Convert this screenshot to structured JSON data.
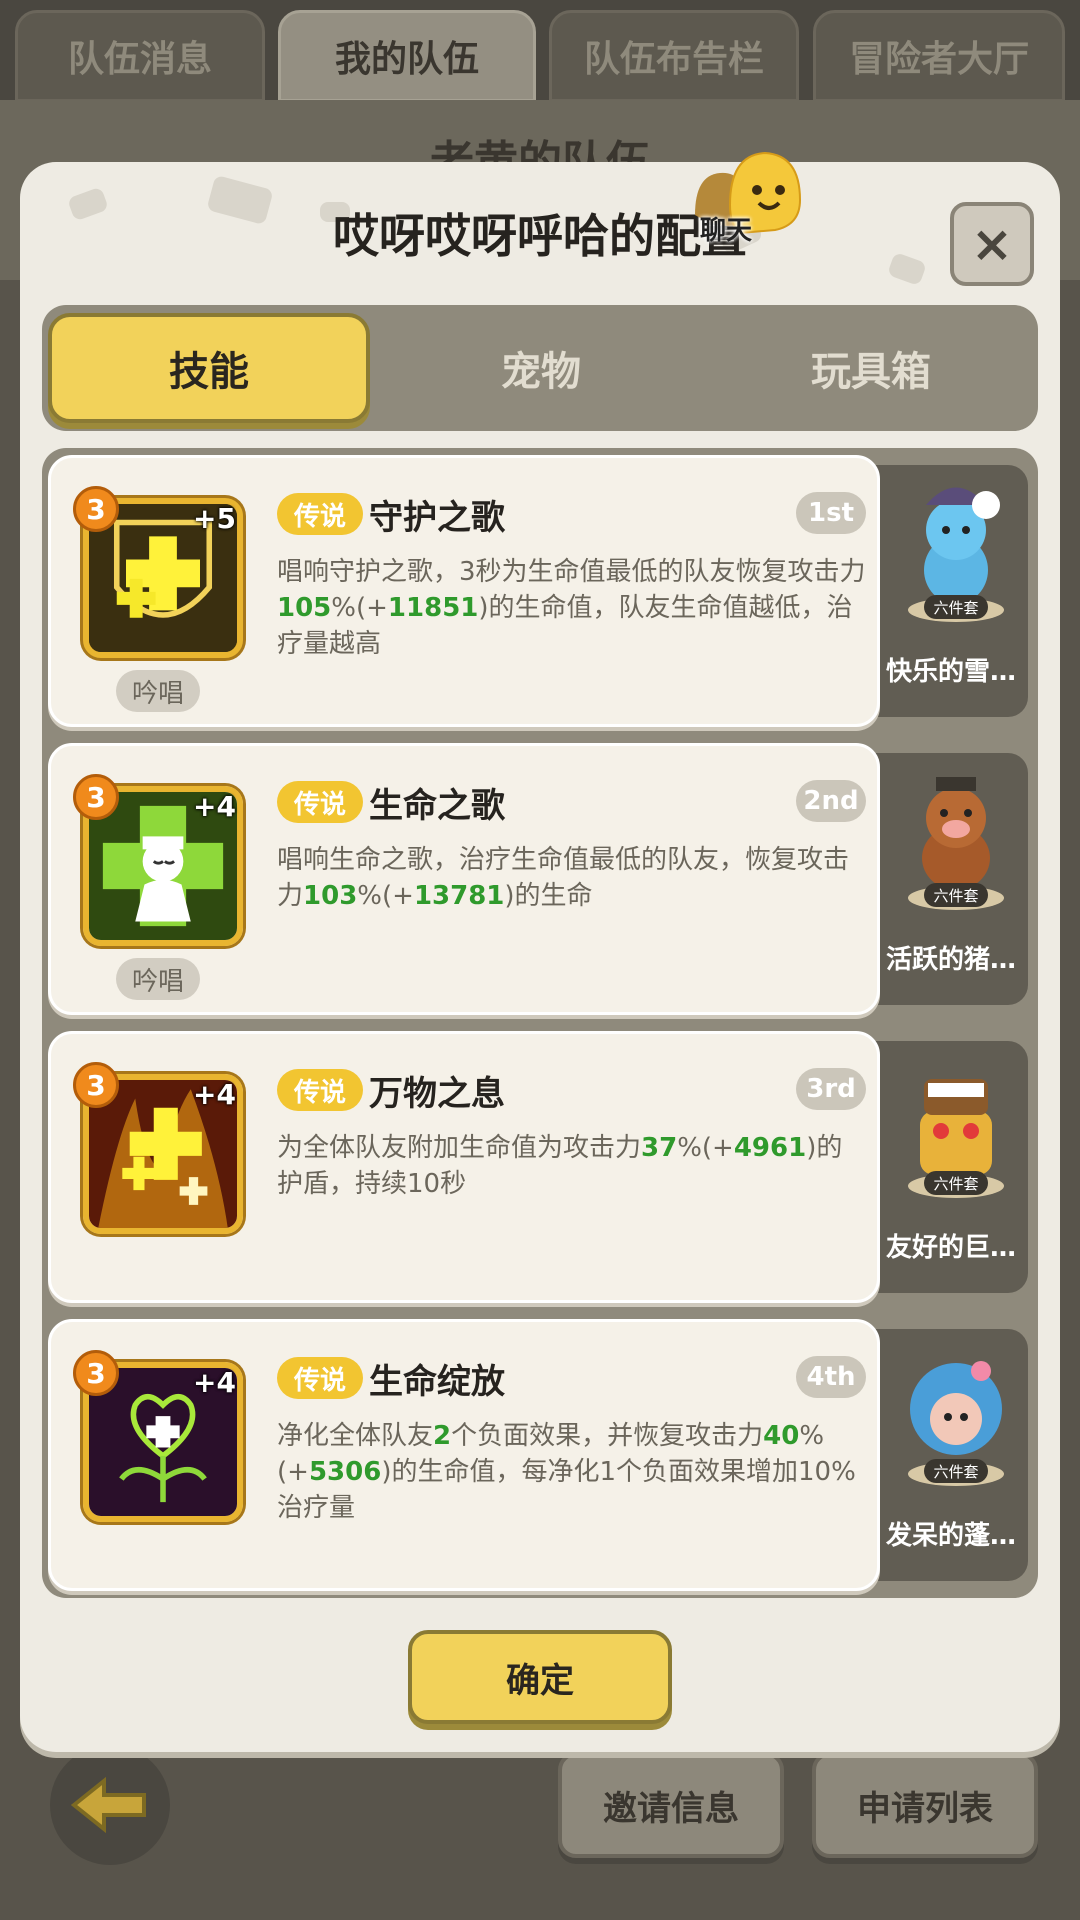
{
  "top_tabs": [
    "队伍消息",
    "我的队伍",
    "队伍布告栏",
    "冒险者大厅"
  ],
  "background_title": "老黄的队伍",
  "modal": {
    "title": "哎呀哎呀呼哈的配置",
    "chat_label": "聊天",
    "close_symbol": "×",
    "tabs": [
      "技能",
      "宠物",
      "玩具箱"
    ],
    "active_tab": "技能",
    "confirm_label": "确定"
  },
  "skills": [
    {
      "level": "3",
      "plus": "+5",
      "chant": "吟唱",
      "rarity": "传说",
      "name": "守护之歌",
      "rank": "1st",
      "desc_parts": [
        "唱响守护之歌，3秒为生命值最低的队友恢复攻击力",
        "105",
        "%(+",
        "11851",
        ")的生命值，队友生命值越低，治疗量越高"
      ],
      "pet_name": "快乐的雪…",
      "pet_set": "六件套",
      "icon": "shield-cross-icon"
    },
    {
      "level": "3",
      "plus": "+4",
      "chant": "吟唱",
      "rarity": "传说",
      "name": "生命之歌",
      "rank": "2nd",
      "desc_parts": [
        "唱响生命之歌，治疗生命值最低的队友，恢复攻击力",
        "103",
        "%(+",
        "13781",
        ")的生命"
      ],
      "pet_name": "活跃的猪…",
      "pet_set": "六件套",
      "icon": "singer-cross-icon"
    },
    {
      "level": "3",
      "plus": "+4",
      "chant": "",
      "rarity": "传说",
      "name": "万物之息",
      "rank": "3rd",
      "desc_parts": [
        "为全体队友附加生命值为攻击力",
        "37",
        "%(+",
        "4961",
        ")的护盾，持续10秒"
      ],
      "pet_name": "友好的巨…",
      "pet_set": "六件套",
      "icon": "flame-cross-icon"
    },
    {
      "level": "3",
      "plus": "+4",
      "chant": "",
      "rarity": "传说",
      "name": "生命绽放",
      "rank": "4th",
      "desc_parts": [
        "净化全体队友",
        "2",
        "个负面效果，并恢复攻击力",
        "40",
        "%(+",
        "5306",
        ")的生命值，每净化1个负面效果增加10%治疗量"
      ],
      "pet_name": "发呆的蓬…",
      "pet_set": "六件套",
      "icon": "heart-flower-icon"
    }
  ],
  "bottom": {
    "invite_label": "邀请信息",
    "apply_label": "申请列表",
    "back_icon": "back-arrow-icon"
  },
  "colors": {
    "accent": "#f2d25a",
    "legend": "#f2c531",
    "green": "#2f9a2c"
  }
}
